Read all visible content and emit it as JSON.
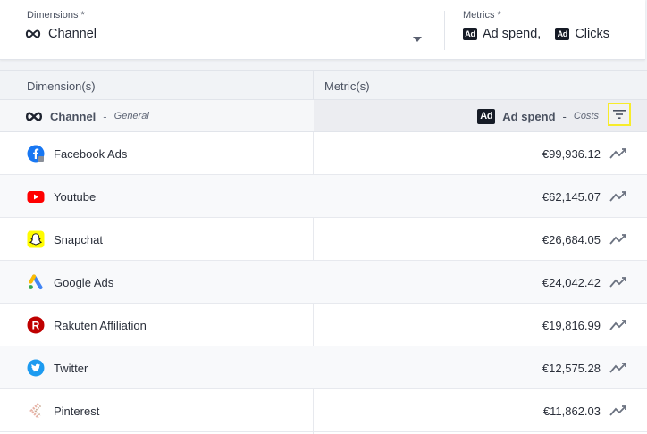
{
  "dimensions": {
    "label": "Dimensions *",
    "value": "Channel",
    "icon": "infinity-icon"
  },
  "metrics": {
    "label": "Metrics *",
    "badge": "Ad",
    "items": [
      "Ad spend,",
      "Clicks"
    ]
  },
  "table": {
    "col_dimension": "Dimension(s)",
    "col_metric": "Metric(s)",
    "dimension_name": "Channel",
    "dimension_category": "General",
    "metric_name": "Ad spend",
    "metric_category": "Costs",
    "dash": "-",
    "rows": [
      {
        "channel": "Facebook Ads",
        "value": "€99,936.12",
        "logo": "facebook-logo"
      },
      {
        "channel": "Youtube",
        "value": "€62,145.07",
        "logo": "youtube-logo"
      },
      {
        "channel": "Snapchat",
        "value": "€26,684.05",
        "logo": "snapchat-logo"
      },
      {
        "channel": "Google Ads",
        "value": "€24,042.42",
        "logo": "google-ads-logo"
      },
      {
        "channel": "Rakuten Affiliation",
        "value": "€19,816.99",
        "logo": "rakuten-logo"
      },
      {
        "channel": "Twitter",
        "value": "€12,575.28",
        "logo": "twitter-logo"
      },
      {
        "channel": "Pinterest",
        "value": "€11,862.03",
        "logo": "pinterest-logo"
      }
    ]
  },
  "colors": {
    "filter_highlight": "#f7ec2a",
    "ad_badge": "#161b26",
    "trend_icon": "#6b7280"
  }
}
